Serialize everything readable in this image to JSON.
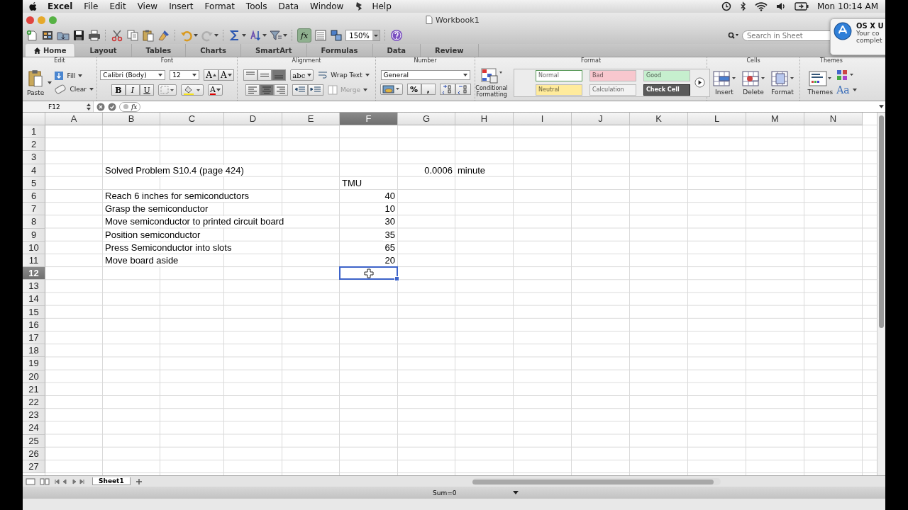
{
  "menubar": {
    "app": "Excel",
    "items": [
      "File",
      "Edit",
      "View",
      "Insert",
      "Format",
      "Tools",
      "Data",
      "Window",
      "Help"
    ],
    "clock": "Mon 10:14 AM"
  },
  "window": {
    "title": "Workbook1"
  },
  "toolbar": {
    "fx": "fx",
    "zoom": "150%",
    "search_placeholder": "Search in Sheet"
  },
  "notification": {
    "title": "OS X U",
    "lines": [
      "Your co",
      "complet"
    ]
  },
  "ribbon_tabs": [
    {
      "label": "Home",
      "selected": true
    },
    {
      "label": "Layout",
      "selected": false
    },
    {
      "label": "Tables",
      "selected": false
    },
    {
      "label": "Charts",
      "selected": false
    },
    {
      "label": "SmartArt",
      "selected": false
    },
    {
      "label": "Formulas",
      "selected": false
    },
    {
      "label": "Data",
      "selected": false
    },
    {
      "label": "Review",
      "selected": false
    }
  ],
  "ribbon": {
    "edit": {
      "title": "Edit",
      "paste": "Paste",
      "fill": "Fill",
      "clear": "Clear"
    },
    "font": {
      "title": "Font",
      "family": "Calibri (Body)",
      "size": "12",
      "grow": "A",
      "shrink": "A",
      "bold": "B",
      "italic": "I",
      "underline": "U",
      "font_color": "A"
    },
    "alignment": {
      "title": "Alignment",
      "abc": "abc",
      "wrap": "Wrap Text",
      "merge": "Merge",
      "merge_disabled": true
    },
    "number": {
      "title": "Number",
      "format": "General",
      "percent": "%",
      "comma": ","
    },
    "format": {
      "title": "Format",
      "conditional": "Conditional Formatting",
      "styles": [
        {
          "label": "Normal",
          "color": "#ffffff"
        },
        {
          "label": "Bad",
          "color": "#f8c7ce"
        },
        {
          "label": "Good",
          "color": "#c6efce"
        },
        {
          "label": "Neutral",
          "color": "#ffeb9c"
        },
        {
          "label": "Calculation",
          "color": "#f2f2f2"
        },
        {
          "label": "Check Cell",
          "color": "#5a5a5a"
        }
      ]
    },
    "cells": {
      "title": "Cells",
      "buttons": [
        "Insert",
        "Delete",
        "Format"
      ]
    },
    "themes": {
      "title": "Themes",
      "themes": "Themes",
      "fonts": "Aa"
    }
  },
  "formula_bar": {
    "name_box": "F12",
    "fx": "fx"
  },
  "sheet": {
    "columns": [
      {
        "label": "A",
        "selected": false
      },
      {
        "label": "B",
        "selected": false
      },
      {
        "label": "C",
        "selected": false
      },
      {
        "label": "D",
        "selected": false
      },
      {
        "label": "E",
        "selected": false
      },
      {
        "label": "F",
        "selected": true
      },
      {
        "label": "G",
        "selected": false
      },
      {
        "label": "H",
        "selected": false
      },
      {
        "label": "I",
        "selected": false
      },
      {
        "label": "J",
        "selected": false
      },
      {
        "label": "K",
        "selected": false
      },
      {
        "label": "L",
        "selected": false
      },
      {
        "label": "M",
        "selected": false
      },
      {
        "label": "N",
        "selected": false
      }
    ],
    "rows": [
      {
        "label": "1",
        "selected": false,
        "cells": []
      },
      {
        "label": "2",
        "selected": false,
        "cells": []
      },
      {
        "label": "3",
        "selected": false,
        "cells": []
      },
      {
        "label": "4",
        "selected": false,
        "cells": [
          "",
          "Solved Problem S10.4 (page 424)",
          "",
          "",
          "",
          "",
          "0.0006",
          "minute"
        ]
      },
      {
        "label": "5",
        "selected": false,
        "cells": [
          "",
          "",
          "",
          "",
          "",
          "TMU"
        ]
      },
      {
        "label": "6",
        "selected": false,
        "cells": [
          "",
          "Reach 6 inches for semiconductors",
          "",
          "",
          "",
          "40"
        ]
      },
      {
        "label": "7",
        "selected": false,
        "cells": [
          "",
          "Grasp the semiconductor",
          "",
          "",
          "",
          "10"
        ]
      },
      {
        "label": "8",
        "selected": false,
        "cells": [
          "",
          "Move semiconductor to printed circuit board",
          "",
          "",
          "",
          "30"
        ]
      },
      {
        "label": "9",
        "selected": false,
        "cells": [
          "",
          "Position semiconductor",
          "",
          "",
          "",
          "35"
        ]
      },
      {
        "label": "10",
        "selected": false,
        "cells": [
          "",
          "Press Semiconductor into slots",
          "",
          "",
          "",
          "65"
        ]
      },
      {
        "label": "11",
        "selected": false,
        "cells": [
          "",
          "Move board aside",
          "",
          "",
          "",
          "20"
        ]
      },
      {
        "label": "12",
        "selected": true,
        "cells": []
      },
      {
        "label": "13",
        "selected": false,
        "cells": []
      },
      {
        "label": "14",
        "selected": false,
        "cells": []
      },
      {
        "label": "15",
        "selected": false,
        "cells": []
      },
      {
        "label": "16",
        "selected": false,
        "cells": []
      },
      {
        "label": "17",
        "selected": false,
        "cells": []
      },
      {
        "label": "18",
        "selected": false,
        "cells": []
      },
      {
        "label": "19",
        "selected": false,
        "cells": []
      },
      {
        "label": "20",
        "selected": false,
        "cells": []
      },
      {
        "label": "21",
        "selected": false,
        "cells": []
      },
      {
        "label": "22",
        "selected": false,
        "cells": []
      },
      {
        "label": "23",
        "selected": false,
        "cells": []
      },
      {
        "label": "24",
        "selected": false,
        "cells": []
      },
      {
        "label": "25",
        "selected": false,
        "cells": []
      },
      {
        "label": "26",
        "selected": false,
        "cells": []
      },
      {
        "label": "27",
        "selected": false,
        "cells": []
      }
    ]
  },
  "sheet_tabs": [
    {
      "label": "Sheet1",
      "selected": true
    }
  ],
  "status_bar": {
    "sum": "Sum=0"
  }
}
